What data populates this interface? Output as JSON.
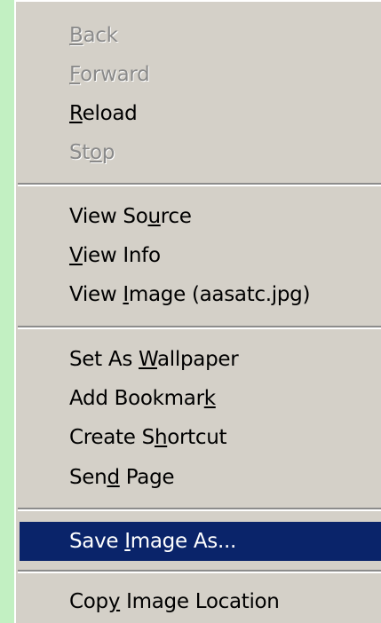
{
  "context_menu": {
    "items": [
      {
        "pre": "",
        "key": "B",
        "post": "ack",
        "enabled": false,
        "selected": false
      },
      {
        "pre": "",
        "key": "F",
        "post": "orward",
        "enabled": false,
        "selected": false
      },
      {
        "pre": "",
        "key": "R",
        "post": "eload",
        "enabled": true,
        "selected": false
      },
      {
        "pre": "St",
        "key": "o",
        "post": "p",
        "enabled": false,
        "selected": false
      },
      {
        "pre": "View So",
        "key": "u",
        "post": "rce",
        "enabled": true,
        "selected": false
      },
      {
        "pre": "",
        "key": "V",
        "post": "iew Info",
        "enabled": true,
        "selected": false
      },
      {
        "pre": "View ",
        "key": "I",
        "post": "mage (aasatc.jpg)",
        "enabled": true,
        "selected": false
      },
      {
        "pre": "Set As ",
        "key": "W",
        "post": "allpaper",
        "enabled": true,
        "selected": false
      },
      {
        "pre": "Add Bookmar",
        "key": "k",
        "post": "",
        "enabled": true,
        "selected": false
      },
      {
        "pre": "Create S",
        "key": "h",
        "post": "ortcut",
        "enabled": true,
        "selected": false
      },
      {
        "pre": "Sen",
        "key": "d",
        "post": " Page",
        "enabled": true,
        "selected": false
      },
      {
        "pre": "Save ",
        "key": "I",
        "post": "mage As...",
        "enabled": true,
        "selected": true
      },
      {
        "pre": "Cop",
        "key": "y",
        "post": " Image Location",
        "enabled": true,
        "selected": false
      }
    ],
    "colors": {
      "menu_background": "#d4d0c8",
      "selection_background": "#0a246a",
      "selection_text": "#ffffff",
      "disabled_text": "#8a8a8a",
      "page_background": "#c2f0c2"
    }
  }
}
